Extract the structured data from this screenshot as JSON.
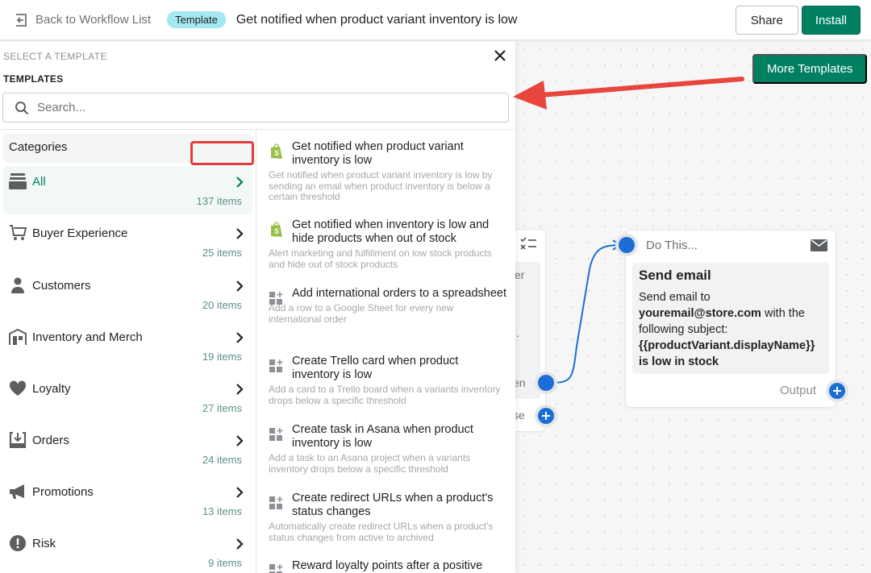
{
  "topbar": {
    "back_label": "Back to Workflow List",
    "badge": "Template",
    "title": "Get notified when product variant inventory is low",
    "share_label": "Share",
    "install_label": "Install"
  },
  "canvas": {
    "more_templates_label": "More Templates",
    "trigger_node": {
      "partial_text_1": "er",
      "partial_text_2": ".",
      "then_label": "en",
      "else_label": "se"
    },
    "action_node": {
      "header": "Do This...",
      "title": "Send email",
      "text_prefix": "Send email to",
      "email": "youremail@store.com",
      "text_middle": "with the following subject:",
      "subject": "{{productVariant.displayName}} is low in stock",
      "output_label": "Output"
    }
  },
  "panel": {
    "select_label": "SELECT A TEMPLATE",
    "templates_label": "TEMPLATES",
    "search_placeholder": "Search...",
    "search_value": "",
    "categories_header": "Categories",
    "categories": [
      {
        "name": "All",
        "count": "137 items",
        "icon": "stack-icon",
        "active": true
      },
      {
        "name": "Buyer Experience",
        "count": "25 items",
        "icon": "cart-icon"
      },
      {
        "name": "Customers",
        "count": "20 items",
        "icon": "person-icon"
      },
      {
        "name": "Inventory and Merch",
        "count": "19 items",
        "icon": "store-icon"
      },
      {
        "name": "Loyalty",
        "count": "27 items",
        "icon": "heart-icon"
      },
      {
        "name": "Orders",
        "count": "24 items",
        "icon": "orders-import-icon"
      },
      {
        "name": "Promotions",
        "count": "13 items",
        "icon": "megaphone-icon"
      },
      {
        "name": "Risk",
        "count": "9 items",
        "icon": "alert-icon"
      }
    ],
    "templates": [
      {
        "title": "Get notified when product variant inventory is low",
        "description": "Get notified when product variant inventory is low by sending an email when product inventory is below a certain threshold",
        "icon": "shopify-icon"
      },
      {
        "title": "Get notified when inventory is low and hide products when out of stock",
        "description": "Alert marketing and fulfillment on low stock products and hide out of stock products",
        "icon": "shopify-icon"
      },
      {
        "title": "Add international orders to a spreadsheet",
        "description": "Add a row to a Google Sheet for every new international order",
        "icon": "app-add-icon"
      },
      {
        "title": "Create Trello card when product inventory is low",
        "description": "Add a card to a Trello board when a variants inventory drops below a specific threshold",
        "icon": "app-add-icon"
      },
      {
        "title": "Create task in Asana when product inventory is low",
        "description": "Add a task to an Asana project when a variants inventory drops below a specific threshold",
        "icon": "app-add-icon"
      },
      {
        "title": "Create redirect URLs when a product's status changes",
        "description": "Automatically create redirect URLs when a product's status changes from active to archived",
        "icon": "app-add-icon"
      },
      {
        "title": "Reward loyalty points after a positive",
        "description": "",
        "icon": "app-add-icon"
      }
    ]
  },
  "colors": {
    "primary": "#008060",
    "badge_bg": "#a4e8f2",
    "port_blue": "#1b6ed6",
    "annotation_red": "#e23b3b",
    "count_text": "#5a8f8a"
  }
}
